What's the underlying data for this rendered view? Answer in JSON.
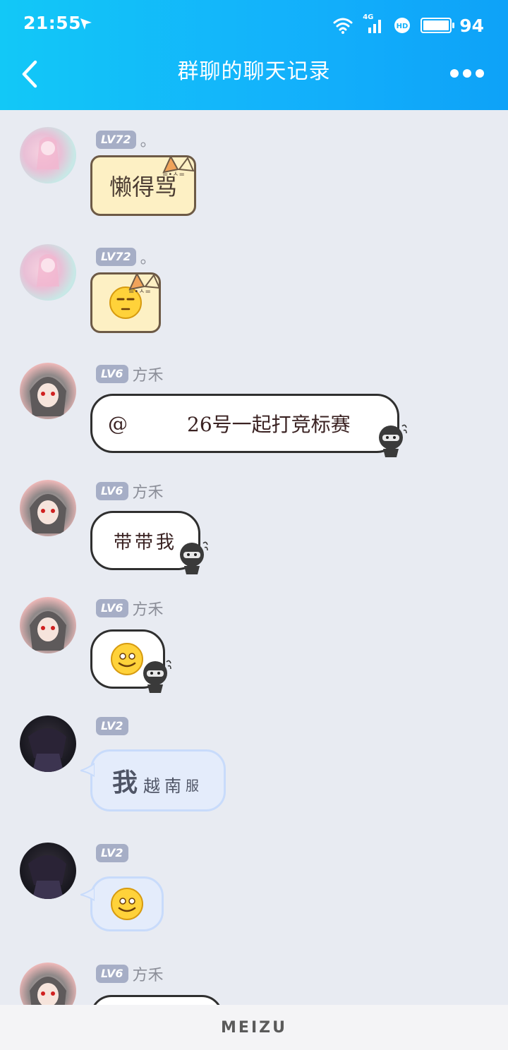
{
  "status_bar": {
    "time": "21:55",
    "network": "4G",
    "battery": "94"
  },
  "header": {
    "title": "群聊的聊天记录"
  },
  "messages": [
    {
      "level": "LV72",
      "nickname": "。",
      "text": "懒得骂",
      "style": "cat"
    },
    {
      "level": "LV72",
      "nickname": "。",
      "text": "",
      "emoji": "emoji-face-icon",
      "style": "cat"
    },
    {
      "level": "LV6",
      "nickname": "方禾",
      "mention": "@",
      "text": "26号一起打竞标赛",
      "style": "ink"
    },
    {
      "level": "LV6",
      "nickname": "方禾",
      "text": "带带我",
      "style": "ink"
    },
    {
      "level": "LV6",
      "nickname": "方禾",
      "text": "",
      "emoji": "emoji-face-icon",
      "style": "ink"
    },
    {
      "level": "LV2",
      "nickname": "",
      "text": "我越南服",
      "text_parts": [
        "我",
        "越",
        "南",
        "服"
      ],
      "style": "blue"
    },
    {
      "level": "LV2",
      "nickname": "",
      "text": "",
      "emoji": "emoji-face-icon",
      "style": "blue"
    },
    {
      "level": "LV6",
      "nickname": "方禾",
      "text": "",
      "style": "ink"
    }
  ],
  "footer": {
    "brand": "MEIZU"
  },
  "colors": {
    "header_start": "#12c8f7",
    "header_end": "#0ea2f8",
    "background": "#e8ebf2",
    "level_badge": "#a6aec6"
  }
}
